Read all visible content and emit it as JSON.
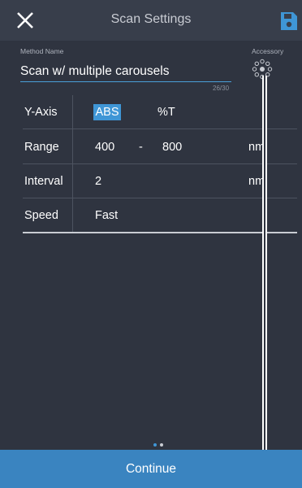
{
  "header": {
    "title": "Scan Settings",
    "close_icon": "close-icon",
    "save_icon": "save-icon"
  },
  "method": {
    "label": "Method Name",
    "value": "Scan w/ multiple carousels",
    "counter": "26/30"
  },
  "accessory": {
    "label": "Accessory",
    "icon": "carousel-icon"
  },
  "rows": {
    "yaxis": {
      "label": "Y-Axis",
      "option_abs": "ABS",
      "option_t": "%T",
      "selected": "ABS"
    },
    "range": {
      "label": "Range",
      "start": "400",
      "separator": "-",
      "end": "800",
      "unit": "nm"
    },
    "interval": {
      "label": "Interval",
      "value": "2",
      "unit": "nm"
    },
    "speed": {
      "label": "Speed",
      "value": "Fast"
    }
  },
  "pager": {
    "pages": 2,
    "current": 1
  },
  "footer": {
    "continue_label": "Continue"
  },
  "colors": {
    "background": "#2f3440",
    "topbar": "#383e4b",
    "accent": "#3f96d6",
    "continue": "#3a84c0"
  }
}
